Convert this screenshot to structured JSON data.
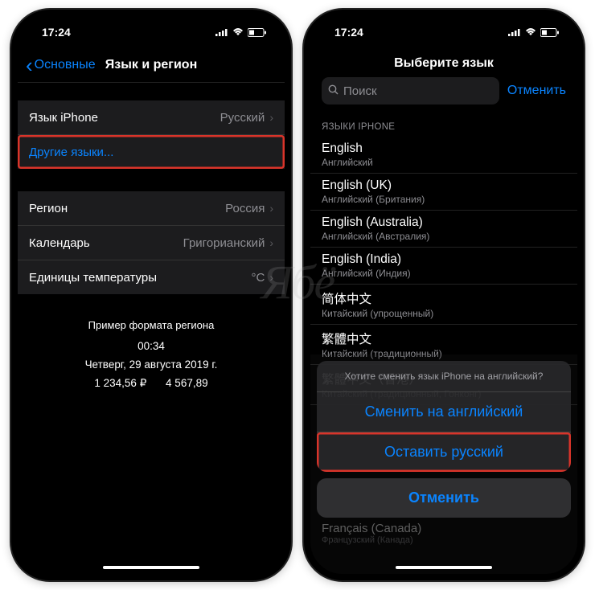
{
  "status": {
    "time": "17:24"
  },
  "screen1": {
    "back": "Основные",
    "title": "Язык и регион",
    "rows": {
      "iphone_lang_label": "Язык iPhone",
      "iphone_lang_value": "Русский",
      "other_langs": "Другие языки...",
      "region_label": "Регион",
      "region_value": "Россия",
      "calendar_label": "Календарь",
      "calendar_value": "Григорианский",
      "temp_label": "Единицы температуры",
      "temp_value": "°C"
    },
    "example": {
      "heading": "Пример формата региона",
      "time": "00:34",
      "date": "Четверг, 29 августа 2019 г.",
      "num1": "1 234,56 ₽",
      "num2": "4 567,89"
    }
  },
  "screen2": {
    "title": "Выберите язык",
    "search_placeholder": "Поиск",
    "cancel": "Отменить",
    "section_label": "ЯЗЫКИ IPHONE",
    "languages": [
      {
        "native": "English",
        "sub": "Английский"
      },
      {
        "native": "English (UK)",
        "sub": "Английский (Британия)"
      },
      {
        "native": "English (Australia)",
        "sub": "Английский (Австралия)"
      },
      {
        "native": "English (India)",
        "sub": "Английский (Индия)"
      },
      {
        "native": "简体中文",
        "sub": "Китайский (упрощенный)"
      },
      {
        "native": "繁體中文",
        "sub": "Китайский (традиционный)"
      },
      {
        "native": "繁體中文（香港）",
        "sub": "Китайский (традиционный, Гонконг)"
      }
    ],
    "sheet": {
      "prompt": "Хотите сменить язык iPhone на английский?",
      "change": "Сменить на английский",
      "keep": "Оставить русский",
      "cancel": "Отменить"
    },
    "below": {
      "native": "Français (Canada)",
      "sub": "Французский (Канада)"
    }
  },
  "watermark": "Ябё"
}
